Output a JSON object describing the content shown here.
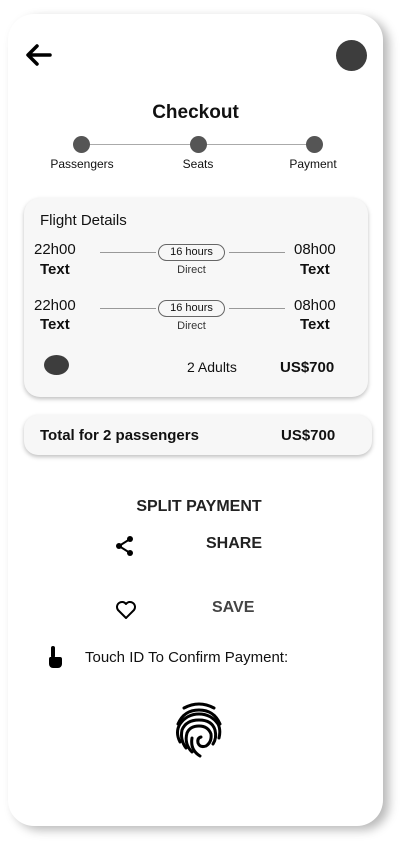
{
  "header": {
    "title": "Checkout"
  },
  "steps": [
    {
      "label": "Passengers"
    },
    {
      "label": "Seats"
    },
    {
      "label": "Payment"
    }
  ],
  "flight": {
    "title": "Flight Details",
    "legs": [
      {
        "depart_time": "22h00",
        "depart_city": "Text",
        "duration": "16 hours",
        "type": "Direct",
        "arrive_time": "08h00",
        "arrive_city": "Text"
      },
      {
        "depart_time": "22h00",
        "depart_city": "Text",
        "duration": "16 hours",
        "type": "Direct",
        "arrive_time": "08h00",
        "arrive_city": "Text"
      }
    ],
    "passengers": "2 Adults",
    "price": "US$700"
  },
  "total": {
    "label": "Total for 2 passengers",
    "price": "US$700"
  },
  "actions": {
    "split": "SPLIT PAYMENT",
    "share": "SHARE",
    "save": "SAVE"
  },
  "touch": {
    "label": "Touch ID To Confirm Payment:"
  }
}
